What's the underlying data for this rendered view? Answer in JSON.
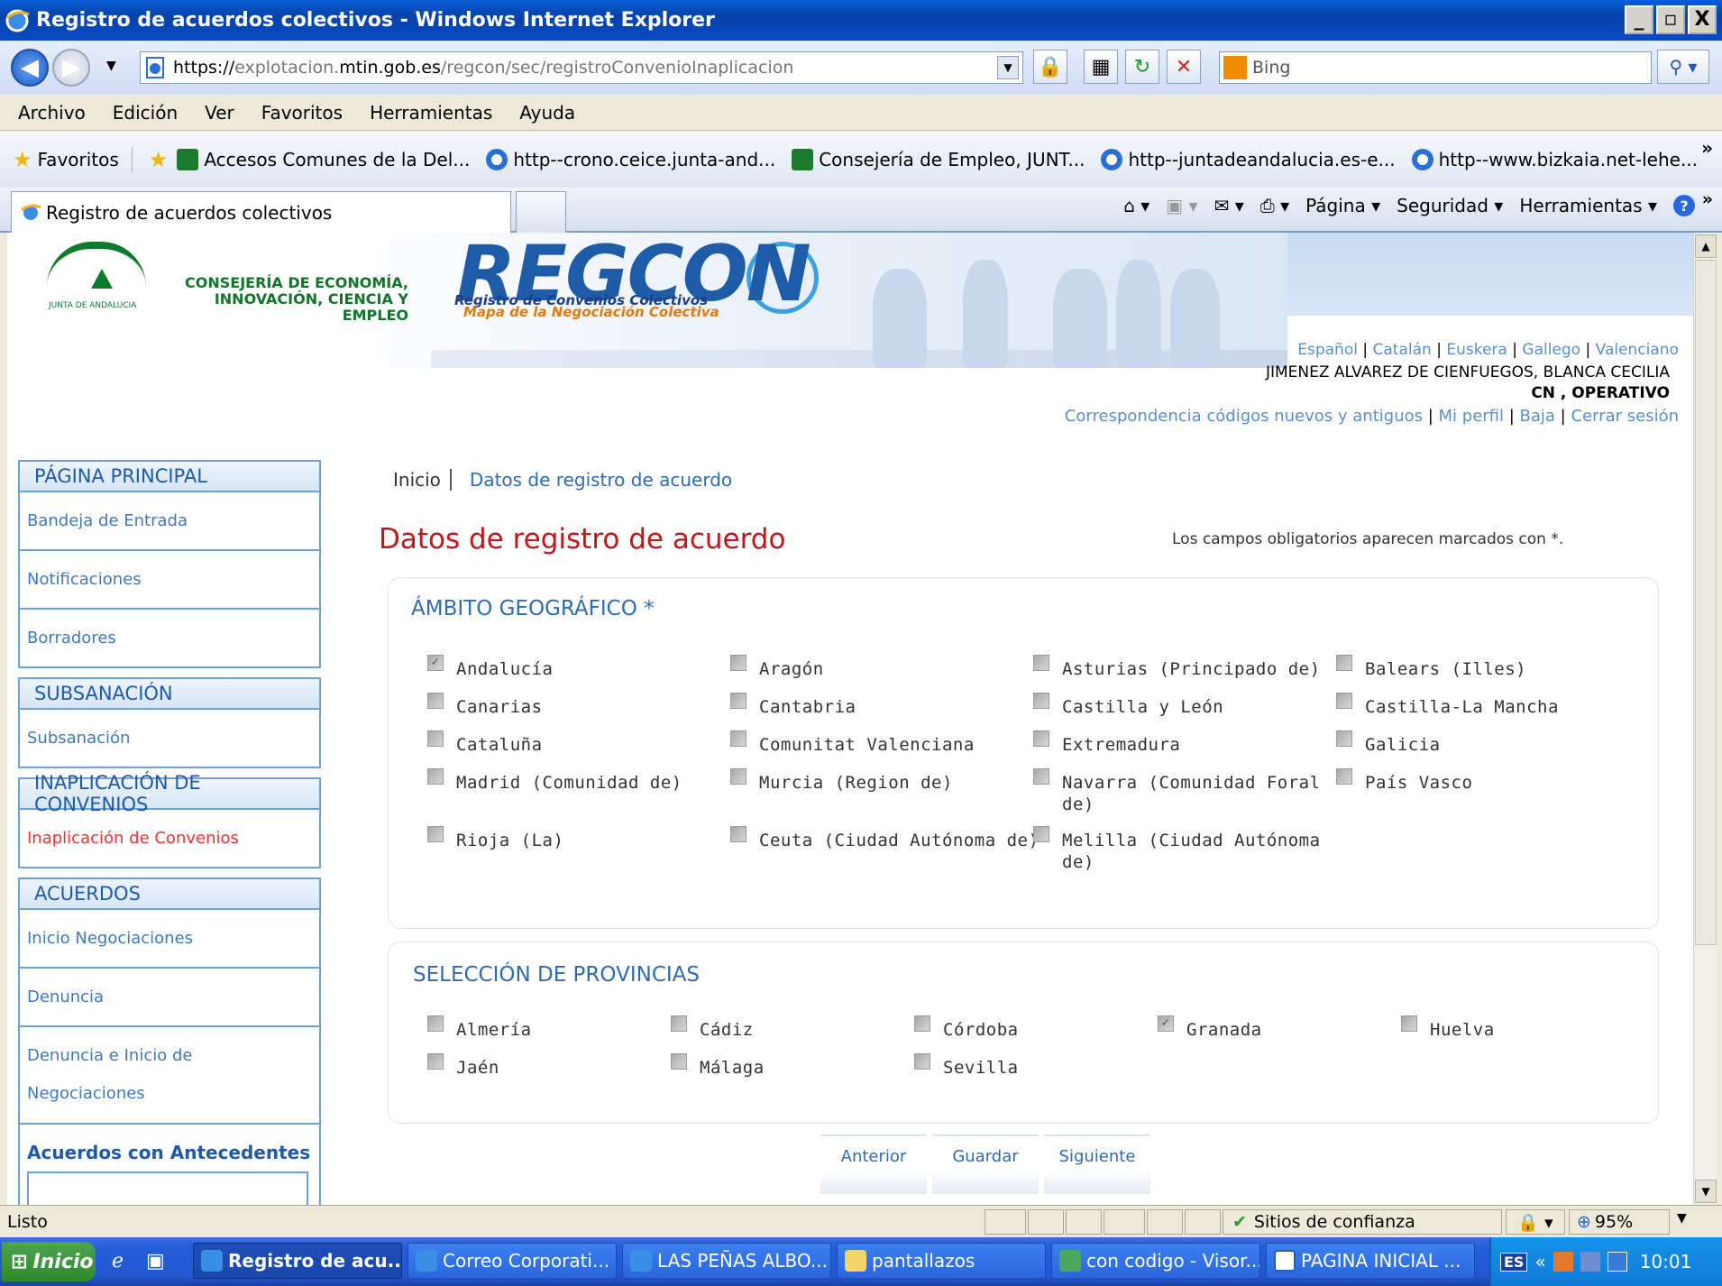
{
  "window": {
    "title": "Registro de acuerdos colectivos - Windows Internet Explorer",
    "minimize": "_",
    "maximize": "▫",
    "close": "X"
  },
  "address": {
    "scheme": "https://",
    "host_prefix": "explotacion.",
    "host_bold": "mtin.gob.es",
    "path": "/regcon/sec/registroConvenioInaplicacion"
  },
  "search": {
    "placeholder": "Bing"
  },
  "menu": [
    "Archivo",
    "Edición",
    "Ver",
    "Favoritos",
    "Herramientas",
    "Ayuda"
  ],
  "favorites": {
    "label": "Favoritos",
    "items": [
      "Accesos Comunes de la Del...",
      "http--crono.ceice.junta-and...",
      "Consejería de Empleo, JUNT...",
      "http--juntadeandalucia.es-e...",
      "http--www.bizkaia.net-lehe..."
    ]
  },
  "tab": {
    "title": "Registro de acuerdos colectivos"
  },
  "commandbar": {
    "pagina": "Página",
    "seguridad": "Seguridad",
    "herramientas": "Herramientas"
  },
  "header": {
    "consejeria_line1": "CONSEJERÍA DE ECONOMÍA,",
    "consejeria_line2": "INNOVACIÓN, CIENCIA Y EMPLEO",
    "junta": "JUNTA DE ANDALUCIA",
    "brand": "REGCON",
    "brand_sub1": "Registro de Convenios Colectivos",
    "brand_sub2": "Mapa de la Negociación Colectiva"
  },
  "user": {
    "languages": [
      "Español",
      "Catalán",
      "Euskera",
      "Gallego",
      "Valenciano"
    ],
    "name": "JIMENEZ ALVAREZ DE CIENFUEGOS, BLANCA CECILIA",
    "role": "CN , OPERATIVO",
    "links": [
      "Correspondencia códigos nuevos y antiguos",
      "Mi perfil",
      "Baja",
      "Cerrar sesión"
    ]
  },
  "sidebar": {
    "sections": [
      {
        "title": "PÁGINA PRINCIPAL",
        "items": [
          "Bandeja de Entrada",
          "Notificaciones",
          "Borradores"
        ]
      },
      {
        "title": "SUBSANACIÓN",
        "items": [
          "Subsanación"
        ]
      },
      {
        "title": "INAPLICACIÓN DE CONVENIOS",
        "items": [
          "Inaplicación de Convenios"
        ]
      },
      {
        "title": "ACUERDOS",
        "items": [
          "Inicio Negociaciones",
          "Denuncia",
          "Denuncia e Inicio de Negociaciones",
          "Acuerdos con Antecedentes"
        ]
      }
    ]
  },
  "breadcrumb": {
    "home": "Inicio",
    "current": "Datos de registro de acuerdo"
  },
  "main": {
    "title": "Datos de registro de acuerdo",
    "required_note": "Los campos obligatorios aparecen marcados con *."
  },
  "ambito": {
    "title": "ÁMBITO GEOGRÁFICO *",
    "options": [
      {
        "label": "Andalucía",
        "checked": true
      },
      {
        "label": "Aragón",
        "checked": false
      },
      {
        "label": "Asturias (Principado de)",
        "checked": false
      },
      {
        "label": "Balears (Illes)",
        "checked": false
      },
      {
        "label": "Canarias",
        "checked": false
      },
      {
        "label": "Cantabria",
        "checked": false
      },
      {
        "label": "Castilla y León",
        "checked": false
      },
      {
        "label": "Castilla-La Mancha",
        "checked": false
      },
      {
        "label": "Cataluña",
        "checked": false
      },
      {
        "label": "Comunitat Valenciana",
        "checked": false
      },
      {
        "label": "Extremadura",
        "checked": false
      },
      {
        "label": "Galicia",
        "checked": false
      },
      {
        "label": "Madrid (Comunidad de)",
        "checked": false
      },
      {
        "label": "Murcia (Region de)",
        "checked": false
      },
      {
        "label": "Navarra (Comunidad Foral de)",
        "checked": false
      },
      {
        "label": "País Vasco",
        "checked": false
      },
      {
        "label": "Rioja (La)",
        "checked": false
      },
      {
        "label": "Ceuta (Ciudad Autónoma de)",
        "checked": false
      },
      {
        "label": "Melilla (Ciudad Autónoma de)",
        "checked": false
      }
    ]
  },
  "provincias": {
    "title": "SELECCIÓN DE PROVINCIAS",
    "options": [
      {
        "label": "Almería",
        "checked": false
      },
      {
        "label": "Cádiz",
        "checked": false
      },
      {
        "label": "Córdoba",
        "checked": false
      },
      {
        "label": "Granada",
        "checked": true
      },
      {
        "label": "Huelva",
        "checked": false
      },
      {
        "label": "Jaén",
        "checked": false
      },
      {
        "label": "Málaga",
        "checked": false
      },
      {
        "label": "Sevilla",
        "checked": false
      }
    ]
  },
  "buttons": {
    "prev": "Anterior",
    "save": "Guardar",
    "next": "Siguiente"
  },
  "status": {
    "text": "Listo",
    "zone": "Sitios de confianza",
    "zoom": "95%"
  },
  "taskbar": {
    "start": "Inicio",
    "items": [
      "Registro de acu...",
      "Correo Corporati...",
      "LAS PEÑAS ALBO...",
      "pantallazos",
      "con codigo - Visor...",
      "PAGINA INICIAL ..."
    ],
    "lang": "ES",
    "clock": "10:01"
  }
}
